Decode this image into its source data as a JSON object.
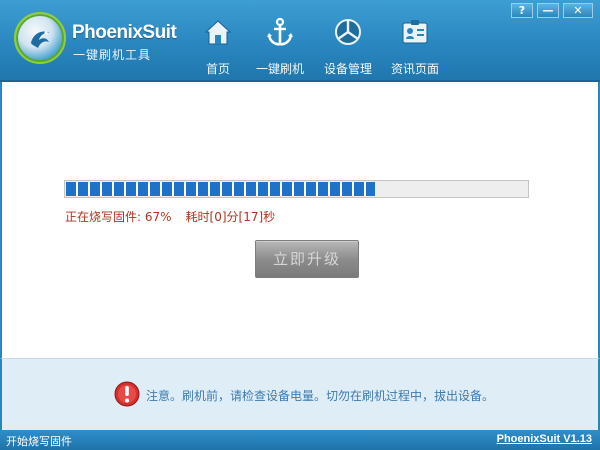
{
  "app": {
    "name": "PhoenixSuit",
    "subtitle": "一键刷机工具",
    "version_link": "PhoenixSuit V1.13"
  },
  "window_controls": {
    "help": "?",
    "minimize": "—",
    "close": "✕"
  },
  "nav": {
    "items": [
      {
        "label": "首页",
        "icon": "home-icon"
      },
      {
        "label": "一键刷机",
        "icon": "anchor-icon"
      },
      {
        "label": "设备管理",
        "icon": "device-icon"
      },
      {
        "label": "资讯页面",
        "icon": "info-card-icon"
      }
    ]
  },
  "flash": {
    "progress_percent": 67,
    "status_label": "正在烧写固件: 67%",
    "elapsed_label": "耗时[0]分[17]秒",
    "upgrade_button": "立即升级"
  },
  "notice": {
    "icon": "warning-icon",
    "text": "注意。刷机前，请检查设备电量。切勿在刷机过程中，拔出设备。"
  },
  "statusbar": {
    "left_text": "开始烧写固件"
  },
  "colors": {
    "header_blue": "#2a86bf",
    "progress_blue": "#1e73c8",
    "status_red": "#b1331d",
    "notice_text": "#3c7ab1"
  }
}
